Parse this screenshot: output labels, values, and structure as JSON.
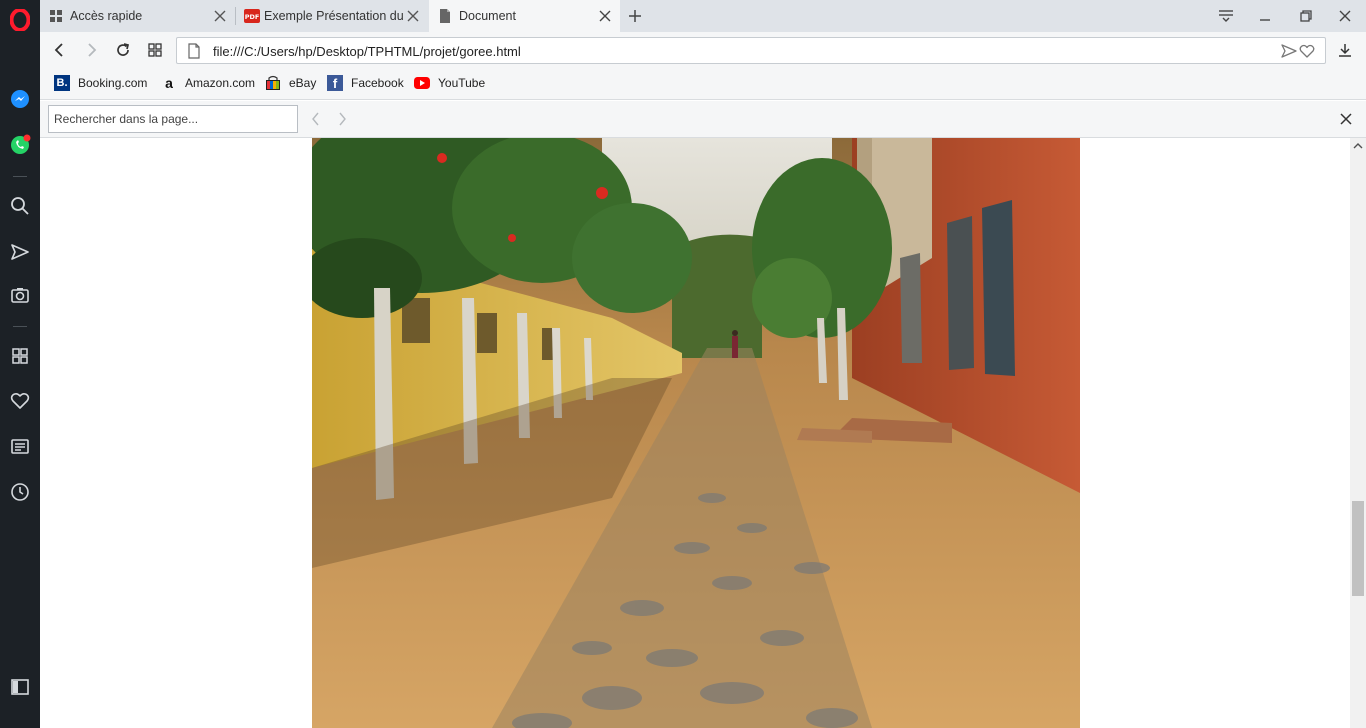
{
  "tabs": [
    {
      "title": "Accès rapide",
      "icon": "grid-icon"
    },
    {
      "title": "Exemple Présentation du p",
      "icon": "pdf-icon"
    },
    {
      "title": "Document",
      "icon": "document-icon"
    }
  ],
  "address": {
    "url": "file:///C:/Users/hp/Desktop/TPHTML/projet/goree.html"
  },
  "bookmarks": [
    {
      "label": "Booking.com",
      "icon": "booking-icon",
      "fav_text": "B.",
      "color": "#003580"
    },
    {
      "label": "Amazon.com",
      "icon": "amazon-icon",
      "fav_text": "a",
      "color": "#111111"
    },
    {
      "label": "eBay",
      "icon": "ebay-icon",
      "color": "#e53238"
    },
    {
      "label": "Facebook",
      "icon": "facebook-icon",
      "fav_text": "f",
      "color": "#3b5998"
    },
    {
      "label": "YouTube",
      "icon": "youtube-icon",
      "color": "#ff0000"
    }
  ],
  "find": {
    "placeholder": "Rechercher dans la page..."
  },
  "content": {
    "image": "photo of a tree-lined sandy cobblestone street between yellow and red colonial buildings"
  },
  "colors": {
    "opera_red": "#ff1b2d",
    "sidebar_bg": "#1c2126",
    "chrome_bg": "#f5f6f7",
    "tabstrip_bg": "#dfe3e8"
  }
}
